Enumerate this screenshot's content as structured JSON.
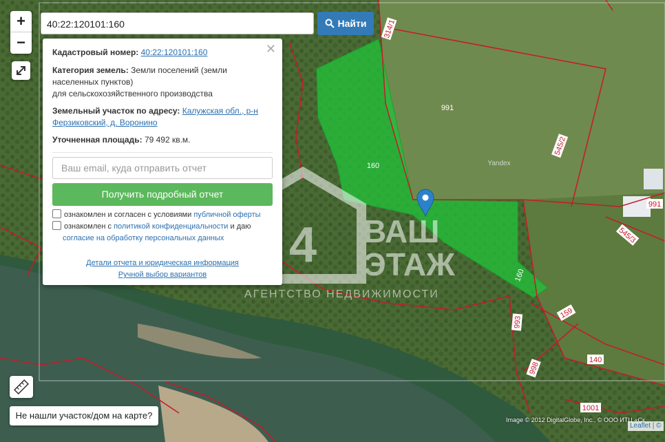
{
  "search": {
    "value": "40:22:120101:160",
    "button_label": "Найти"
  },
  "zoom": {
    "in": "+",
    "out": "−"
  },
  "popup": {
    "cadastral_label": "Кадастровый номер:",
    "cadastral_number": "40:22:120101:160",
    "category_label": "Категория земель:",
    "category_value_1": "Земли поселений (земли",
    "category_value_2": "населенных пунктов)",
    "category_value_3": "для сельскохозяйственного производства",
    "address_label": "Земельный участок по адресу:",
    "address_link_1": "Калужская обл., р-н",
    "address_link_2": "Ферзиковский, д. Воронино",
    "area_label": "Уточненная площадь:",
    "area_value": "79 492 кв.м.",
    "email_placeholder": "Ваш email, куда отправить отчет",
    "report_button": "Получить подробный отчет",
    "consent1_text": "ознакомлен и согласен с условиями",
    "consent1_link": "публичной оферты",
    "consent2_text": "ознакомлен с",
    "consent2_link": "политикой конфиденциальности",
    "consent2_text2": "и даю",
    "consent2_link2": "согласие на обработку персональных данных",
    "link_details": "Детали отчета и юридическая информация",
    "link_manual": "Ручной выбор вариантов"
  },
  "map_labels": {
    "l314": "314/1",
    "l991a": "991",
    "l991b": "991",
    "l545_2": "545/2",
    "l545_3": "545/3",
    "l160a": "160",
    "l160b": "160",
    "l159": "159",
    "l993": "993",
    "l998": "998",
    "l140": "140",
    "l1001": "1001",
    "yandex": "Yandex"
  },
  "watermark": {
    "line1": "ВАШ",
    "line2": "ЭТАЖ",
    "tagline": "АГЕНТСТВО НЕДВИЖИМОСТИ"
  },
  "not_found_button": "Не нашли участок/дом на карте?",
  "attribution": "Image © 2012 DigitalGlobe, Inc., © ООО ИТЦ «Ск",
  "leaflet": "Leaflet | ©",
  "colors": {
    "parcel_fill": "#22c03a",
    "boundary": "#c8192a",
    "search_button": "#337ab7",
    "report_button": "#5cb85c",
    "marker": "#2b82cb"
  },
  "icons": [
    "search-icon",
    "fullscreen-icon",
    "ruler-icon",
    "close-icon",
    "map-marker-icon"
  ]
}
